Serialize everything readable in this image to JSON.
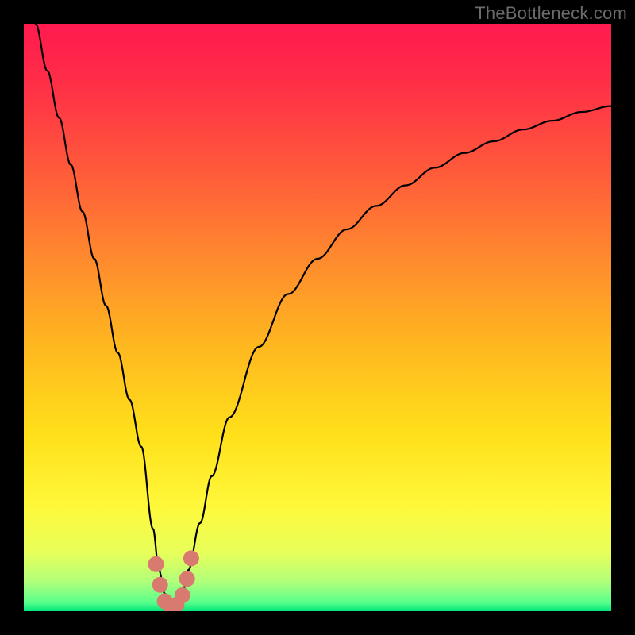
{
  "watermark": "TheBottleneck.com",
  "gradient": {
    "stops": [
      {
        "offset": 0.0,
        "color": "#ff1a4f"
      },
      {
        "offset": 0.1,
        "color": "#ff2e47"
      },
      {
        "offset": 0.25,
        "color": "#ff5a3a"
      },
      {
        "offset": 0.4,
        "color": "#ff8a2e"
      },
      {
        "offset": 0.55,
        "color": "#ffb81f"
      },
      {
        "offset": 0.7,
        "color": "#ffe01a"
      },
      {
        "offset": 0.82,
        "color": "#fff83a"
      },
      {
        "offset": 0.9,
        "color": "#e8ff5a"
      },
      {
        "offset": 0.95,
        "color": "#b0ff7a"
      },
      {
        "offset": 0.985,
        "color": "#5aff8c"
      },
      {
        "offset": 1.0,
        "color": "#00e57a"
      }
    ]
  },
  "chart_data": {
    "type": "line",
    "title": "",
    "xlabel": "",
    "ylabel": "",
    "xlim": [
      0,
      100
    ],
    "ylim": [
      0,
      100
    ],
    "series": [
      {
        "name": "bottleneck-curve",
        "x": [
          2,
          4,
          6,
          8,
          10,
          12,
          14,
          16,
          18,
          20,
          22,
          23,
          24,
          25,
          26,
          27,
          28,
          30,
          32,
          35,
          40,
          45,
          50,
          55,
          60,
          65,
          70,
          75,
          80,
          85,
          90,
          95,
          100
        ],
        "y": [
          100,
          92,
          84,
          76,
          68,
          60,
          52,
          44,
          36,
          28,
          14,
          7,
          3,
          1,
          1,
          3,
          7,
          15,
          23,
          33,
          45,
          54,
          60,
          65,
          69,
          72.5,
          75.5,
          78,
          80,
          82,
          83.5,
          85,
          86
        ]
      }
    ],
    "markers": {
      "name": "minimum-highlight",
      "color": "#d87a70",
      "points": [
        {
          "x": 22.5,
          "y": 8
        },
        {
          "x": 23.2,
          "y": 4.5
        },
        {
          "x": 24.0,
          "y": 1.7
        },
        {
          "x": 25.0,
          "y": 0.8
        },
        {
          "x": 26.0,
          "y": 1.1
        },
        {
          "x": 27.0,
          "y": 2.7
        },
        {
          "x": 27.8,
          "y": 5.5
        },
        {
          "x": 28.5,
          "y": 9
        }
      ]
    }
  }
}
